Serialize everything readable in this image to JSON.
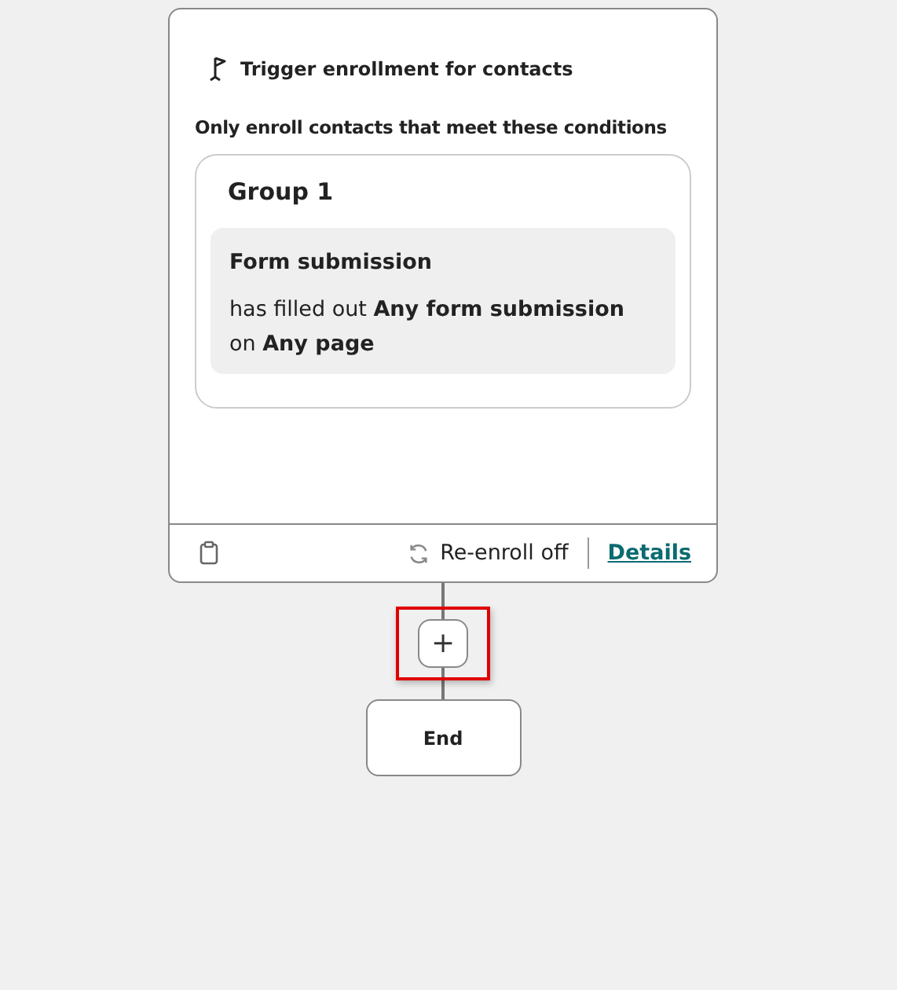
{
  "trigger": {
    "title": "Trigger enrollment for contacts",
    "subtitle": "Only enroll contacts that meet these conditions",
    "group": {
      "title": "Group 1",
      "filters": [
        {
          "title": "Form submission",
          "text": "has filled out **Any form submission** on **Any page**"
        }
      ]
    },
    "reenroll": "Re-enroll off",
    "details": "Details"
  },
  "add_button": {
    "label": "+",
    "highlighted": true
  },
  "end_node": {
    "label": "End"
  }
}
